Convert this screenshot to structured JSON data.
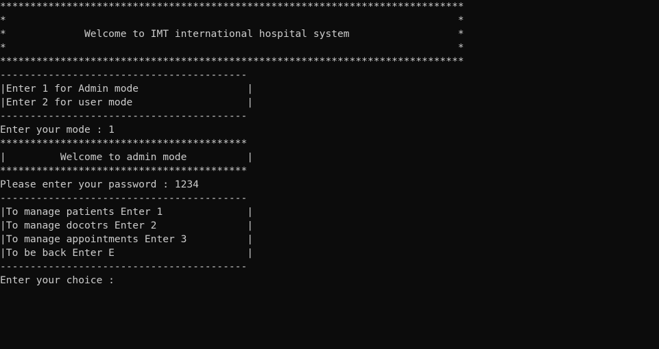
{
  "terminal": {
    "colors": {
      "background": "#0c0c0c",
      "foreground": "#cccccc"
    },
    "lines": [
      "*****************************************************************************",
      "*                                                                           *",
      "*             Welcome to IMT international hospital system                  *",
      "*                                                                           *",
      "*****************************************************************************",
      "-----------------------------------------",
      "|Enter 1 for Admin mode                  |",
      "|Enter 2 for user mode                   |",
      "-----------------------------------------",
      "Enter your mode : 1",
      "*****************************************",
      "|         Welcome to admin mode          |",
      "*****************************************",
      "Please enter your password : 1234",
      "-----------------------------------------",
      "|To manage patients Enter 1              |",
      "|To manage docotrs Enter 2               |",
      "|To manage appointments Enter 3          |",
      "|To be back Enter E                      |",
      "-----------------------------------------",
      "Enter your choice : "
    ]
  }
}
